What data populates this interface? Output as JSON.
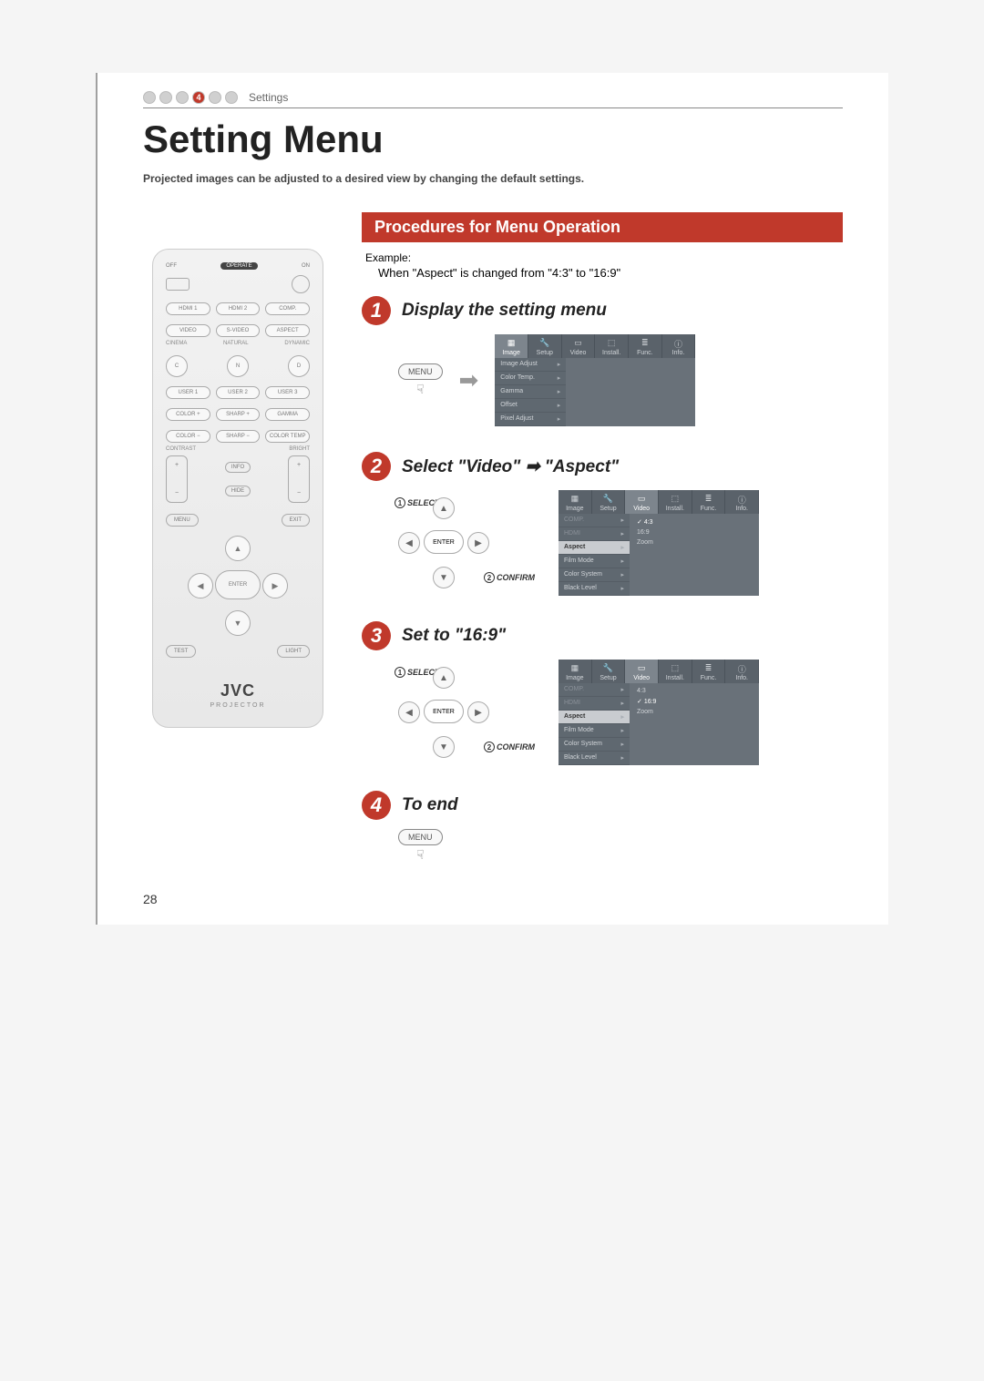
{
  "breadcrumb": {
    "step_active": "4",
    "label": "Settings"
  },
  "title": "Setting Menu",
  "intro": "Projected images can be adjusted to a desired view by changing the default settings.",
  "section_header": "Procedures for Menu Operation",
  "example_label": "Example:",
  "example_text": "When \"Aspect\" is changed from \"4:3\" to \"16:9\"",
  "page_number": "28",
  "steps": {
    "s1": {
      "num": "1",
      "title": "Display the setting menu"
    },
    "s2": {
      "num": "2",
      "title": "Select \"Video\" ➡ \"Aspect\""
    },
    "s3": {
      "num": "3",
      "title": "Set to \"16:9\""
    },
    "s4": {
      "num": "4",
      "title": "To end"
    }
  },
  "menu_button": "MENU",
  "enter_button": "ENTER",
  "annot": {
    "select_num": "1",
    "select": "SELECT",
    "confirm_num": "2",
    "confirm": "CONFIRM"
  },
  "osd_tabs": {
    "image": "Image",
    "setup": "Setup",
    "video": "Video",
    "install": "Install.",
    "func": "Func.",
    "info": "Info."
  },
  "osd1_items": {
    "image_adjust": "Image Adjust",
    "color_temp": "Color Temp.",
    "gamma": "Gamma",
    "offset": "Offset",
    "pixel_adjust": "Pixel Adjust"
  },
  "osd2_left": {
    "comp": "COMP.",
    "hdmi": "HDMI",
    "aspect": "Aspect",
    "film_mode": "Film Mode",
    "color_system": "Color System",
    "black_level": "Black Level"
  },
  "osd2_right": {
    "a43": "4:3",
    "a169": "16:9",
    "zoom": "Zoom"
  },
  "remote": {
    "off": "OFF",
    "on": "ON",
    "operate": "OPERATE",
    "hdmi1": "HDMI 1",
    "hdmi2": "HDMI 2",
    "comp": "COMP.",
    "video": "VIDEO",
    "svideo": "S-VIDEO",
    "aspect": "ASPECT",
    "cinema": "CINEMA",
    "natural": "NATURAL",
    "dynamic": "DYNAMIC",
    "c": "C",
    "n": "N",
    "d": "D",
    "user1": "USER 1",
    "user2": "USER 2",
    "user3": "USER 3",
    "colorp": "COLOR +",
    "sharpp": "SHARP +",
    "gamma": "GAMMA",
    "colorm": "COLOR −",
    "sharpm": "SHARP −",
    "ctemp": "COLOR TEMP",
    "contrast": "CONTRAST",
    "bright": "BRIGHT",
    "info": "INFO",
    "hide": "HIDE",
    "menu": "MENU",
    "exit": "EXIT",
    "enter": "ENTER",
    "test": "TEST",
    "light": "LIGHT",
    "brand": "JVC",
    "subbrand": "PROJECTOR"
  }
}
